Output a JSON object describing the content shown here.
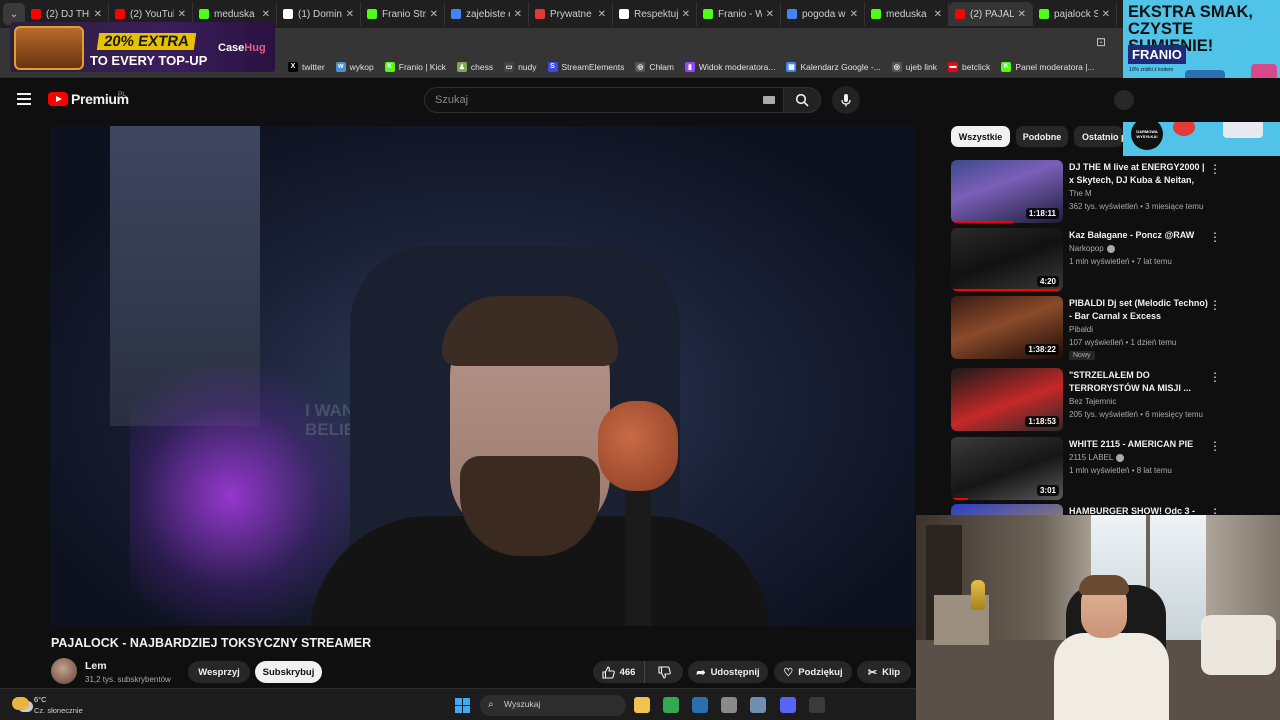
{
  "browser": {
    "tabs": [
      {
        "label": "(2) DJ THE",
        "color": "#ff0000",
        "active": false
      },
      {
        "label": "(2) YouTub",
        "color": "#ff0000",
        "active": false
      },
      {
        "label": "meduska",
        "color": "#53fc18",
        "active": false
      },
      {
        "label": "(1) Domin",
        "color": "#ffffff",
        "active": false
      },
      {
        "label": "Franio Stre",
        "color": "#53fc18",
        "active": false
      },
      {
        "label": "zajebiste c",
        "color": "#4285f4",
        "active": false
      },
      {
        "label": "Prywatne",
        "color": "#e53935",
        "active": false
      },
      {
        "label": "Respektuj",
        "color": "#ffffff",
        "active": false
      },
      {
        "label": "Franio - W",
        "color": "#53fc18",
        "active": false
      },
      {
        "label": "pogoda w",
        "color": "#4285f4",
        "active": false
      },
      {
        "label": "meduska",
        "color": "#53fc18",
        "active": false
      },
      {
        "label": "(2) PAJALC",
        "color": "#ff0000",
        "active": true
      },
      {
        "label": "pajalock S",
        "color": "#53fc18",
        "active": false
      }
    ],
    "tab_close_glyph": "✕",
    "tab_dropdown_glyph": "⌄",
    "bookmarks": [
      {
        "label": "twitter",
        "icon": "x-icon",
        "color": "#000000",
        "glyph": "X"
      },
      {
        "label": "wykop",
        "icon": "wykop-icon",
        "color": "#4a90d9",
        "glyph": "w"
      },
      {
        "label": "Franio | Kick",
        "icon": "kick-icon",
        "color": "#53fc18",
        "glyph": "K"
      },
      {
        "label": "chess",
        "icon": "chess-icon",
        "color": "#7fa650",
        "glyph": "♟"
      },
      {
        "label": "nudy",
        "icon": "folder-icon",
        "color": "#444444",
        "glyph": "▭"
      },
      {
        "label": "StreamElements",
        "icon": "streamelements-icon",
        "color": "#3b4be8",
        "glyph": "S"
      },
      {
        "label": "Chłam",
        "icon": "globe-icon",
        "color": "#555555",
        "glyph": "◎"
      },
      {
        "label": "Widok moderatora...",
        "icon": "twitch-icon",
        "color": "#9146ff",
        "glyph": "▮"
      },
      {
        "label": "Kalendarz Google -...",
        "icon": "calendar-icon",
        "color": "#4285f4",
        "glyph": "▦"
      },
      {
        "label": "ujeb link",
        "icon": "globe-icon",
        "color": "#555555",
        "glyph": "◎"
      },
      {
        "label": "betclick",
        "icon": "betclic-icon",
        "color": "#e30613",
        "glyph": "▬"
      },
      {
        "label": "Panel moderatora |...",
        "icon": "kick-icon",
        "color": "#53fc18",
        "glyph": "K"
      }
    ]
  },
  "ads": {
    "left": {
      "headline": "20% EXTRA",
      "subline": "TO EVERY TOP-UP",
      "brand_a": "Case",
      "brand_b": "Hug"
    },
    "right": {
      "headline": "EKSTRA SMAK, CZYSTE SUMIENIE!",
      "brand": "FRANIO",
      "small": "10% zniżki z kodem",
      "badge": "DARMOWA WYSYŁKA!"
    }
  },
  "youtube": {
    "logo_text": "Premium",
    "region": "PL",
    "search_placeholder": "Szukaj",
    "video": {
      "title": "PAJALOCK - NAJBARDZIEJ TOKSYCZNY STREAMER",
      "sign_text": "I WANT TO BELIEVE",
      "channel": "Lem",
      "subscribers": "31,2 tys. subskrybentów",
      "support_label": "Wesprzyj",
      "subscribe_label": "Subskrybuj",
      "likes": "466",
      "share_label": "Udostępnij",
      "thanks_label": "Podziękuj",
      "clip_label": "Klip"
    },
    "chips": [
      "Wszystkie",
      "Podobne",
      "Ostatnio p"
    ],
    "recommendations": [
      {
        "title": "DJ THE M live at ENERGY2000 | x Skytech, DJ Kuba & Neitan, C...",
        "channel": "The M",
        "verified": false,
        "meta": "362 tys. wyświetleń • 3 miesiące temu",
        "duration": "1:18:11",
        "badge": "",
        "thumb": "linear-gradient(160deg,#3c4a8c,#7b5fb8 40%,#1c1f3a)",
        "progress": 0.55
      },
      {
        "title": "Kaz Bałagane - Poncz @RAW",
        "channel": "Narkopop",
        "verified": true,
        "meta": "1 mln wyświetleń • 7 lat temu",
        "duration": "4:20",
        "badge": "",
        "thumb": "linear-gradient(160deg,#2a2a2a,#111 50%,#3a3a3a)",
        "progress": 1
      },
      {
        "title": "PIBALDI Dj set (Melodic Techno) - Bar Carnal x Excess",
        "channel": "Pibaldi",
        "verified": false,
        "meta": "107 wyświetleń • 1 dzień temu",
        "duration": "1:38:22",
        "badge": "Nowy",
        "thumb": "linear-gradient(160deg,#3a1a14,#8a4a2a 45%,#1a0c08)",
        "progress": 0
      },
      {
        "title": "\"STRZELAŁEM DO TERRORYSTÓW NA MISJI ...",
        "channel": "Bez Tajemnic",
        "verified": false,
        "meta": "205 tys. wyświetleń • 6 miesięcy temu",
        "duration": "1:18:53",
        "badge": "",
        "thumb": "linear-gradient(160deg,#1a1a1a,#c62828 55%,#2a2a2a)",
        "progress": 0
      },
      {
        "title": "WHITE 2115 - AMERICAN PIE",
        "channel": "2115 LABEL",
        "verified": true,
        "meta": "1 mln wyświetleń • 8 lat temu",
        "duration": "3:01",
        "badge": "",
        "thumb": "linear-gradient(160deg,#3a3a3a,#161616 55%,#5a5a5a)",
        "progress": 0.15
      },
      {
        "title": "HAMBURGER SHOW! Odc 3 -",
        "channel": "",
        "verified": false,
        "meta": "",
        "duration": "",
        "badge": "",
        "thumb": "linear-gradient(160deg,#2a3cc8,#e0b030)",
        "progress": 0
      }
    ]
  },
  "taskbar": {
    "temperature": "6°C",
    "weather": "Cz. słonecznie",
    "search_placeholder": "Wyszukaj",
    "apps": [
      {
        "name": "file-explorer-icon",
        "color": "#f2c14e"
      },
      {
        "name": "chrome-icon",
        "color": "#34a853"
      },
      {
        "name": "tools-icon",
        "color": "#2a6fb0"
      },
      {
        "name": "app-icon",
        "color": "#8a8a8a"
      },
      {
        "name": "settings-icon",
        "color": "#6f8fb0"
      },
      {
        "name": "discord-icon",
        "color": "#5865f2"
      },
      {
        "name": "calculator-icon",
        "color": "#3a3a3a"
      }
    ]
  }
}
